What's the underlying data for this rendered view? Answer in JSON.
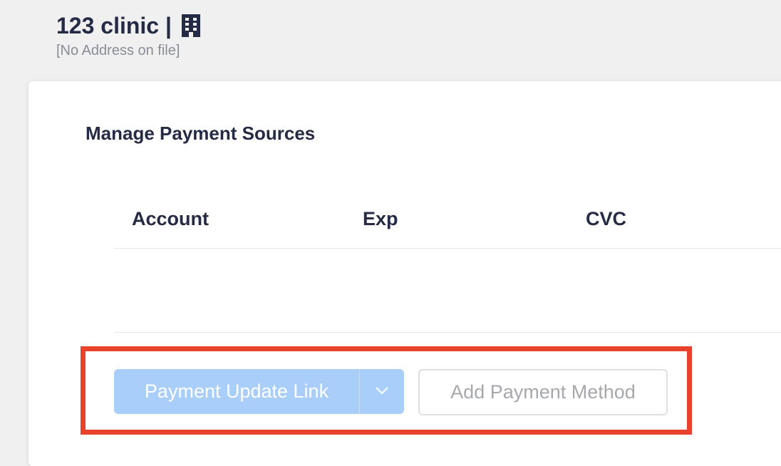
{
  "header": {
    "clinic_name": "123 clinic |",
    "building_icon": "building-icon",
    "address": "[No Address on file]"
  },
  "payment_sources": {
    "title": "Manage Payment Sources",
    "columns": [
      "Account",
      "Exp",
      "CVC"
    ],
    "rows": []
  },
  "actions": {
    "payment_update_link": "Payment Update Link",
    "dropdown_icon": "chevron-down-icon",
    "add_payment_method": "Add Payment Method"
  },
  "colors": {
    "primary_disabled": "#a9cefa",
    "highlight": "#e8412c",
    "heading_text": "#262b45",
    "muted_text": "#8a8d96"
  }
}
